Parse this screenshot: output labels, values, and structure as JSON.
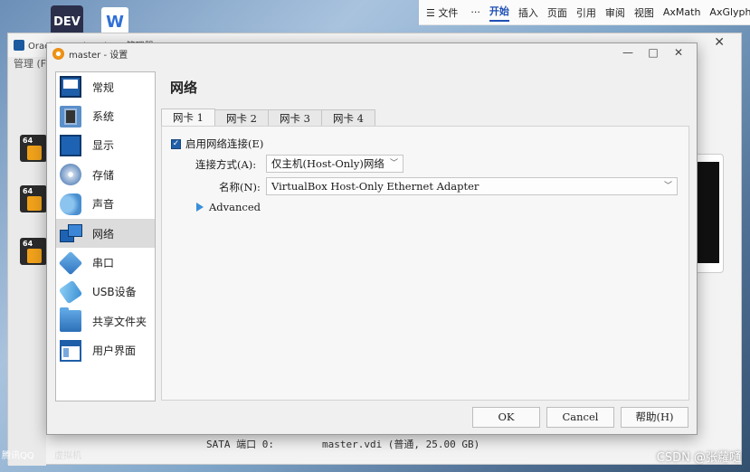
{
  "desktop": {
    "dev_icon_label": "DEV",
    "word_icon_label": "W",
    "taskbar_qq": "腾讯QQ",
    "taskbar_second": "虚拟机",
    "watermark": "CSDN @张蘿嗵"
  },
  "word_ribbon": {
    "file": "文件",
    "more": "···",
    "tabs": [
      "开始",
      "插入",
      "页面",
      "引用",
      "审阅",
      "视图",
      "AxMath",
      "AxGlyph"
    ],
    "active_tab": "开始"
  },
  "manager": {
    "title": "Oracle VM VirtualBox 管理器",
    "label": "管理 (F)",
    "vm_badge": "64",
    "storage_line": "SATA 端口 0:        master.vdi (普通, 25.00 GB)"
  },
  "dialog": {
    "title": "master - 设置",
    "controls": {
      "minimize": "—",
      "maximize": "□",
      "close": "✕"
    },
    "sidebar": [
      {
        "label": "常规",
        "icon": "general-icon"
      },
      {
        "label": "系统",
        "icon": "system-icon"
      },
      {
        "label": "显示",
        "icon": "display-icon"
      },
      {
        "label": "存储",
        "icon": "storage-icon"
      },
      {
        "label": "声音",
        "icon": "audio-icon"
      },
      {
        "label": "网络",
        "icon": "network-icon",
        "selected": true
      },
      {
        "label": "串口",
        "icon": "serial-icon"
      },
      {
        "label": "USB设备",
        "icon": "usb-icon"
      },
      {
        "label": "共享文件夹",
        "icon": "shared-folder-icon"
      },
      {
        "label": "用户界面",
        "icon": "user-interface-icon"
      }
    ],
    "section_title": "网络",
    "tabs": [
      "网卡 1",
      "网卡 2",
      "网卡 3",
      "网卡 4"
    ],
    "active_tab": "网卡 1",
    "enable_checkbox": {
      "label": "启用网络连接(E)",
      "checked": true
    },
    "attached_to": {
      "label": "连接方式(A):",
      "value": "仅主机(Host-Only)网络"
    },
    "name": {
      "label": "名称(N):",
      "value": "VirtualBox Host-Only Ethernet Adapter"
    },
    "advanced_label": "Advanced",
    "buttons": {
      "ok": "OK",
      "cancel": "Cancel",
      "help": "帮助(H)"
    }
  },
  "colors": {
    "accent": "#1f5fa8",
    "selected_item_bg": "#dcdcdc",
    "word_active_tab": "#1f4fb5"
  }
}
